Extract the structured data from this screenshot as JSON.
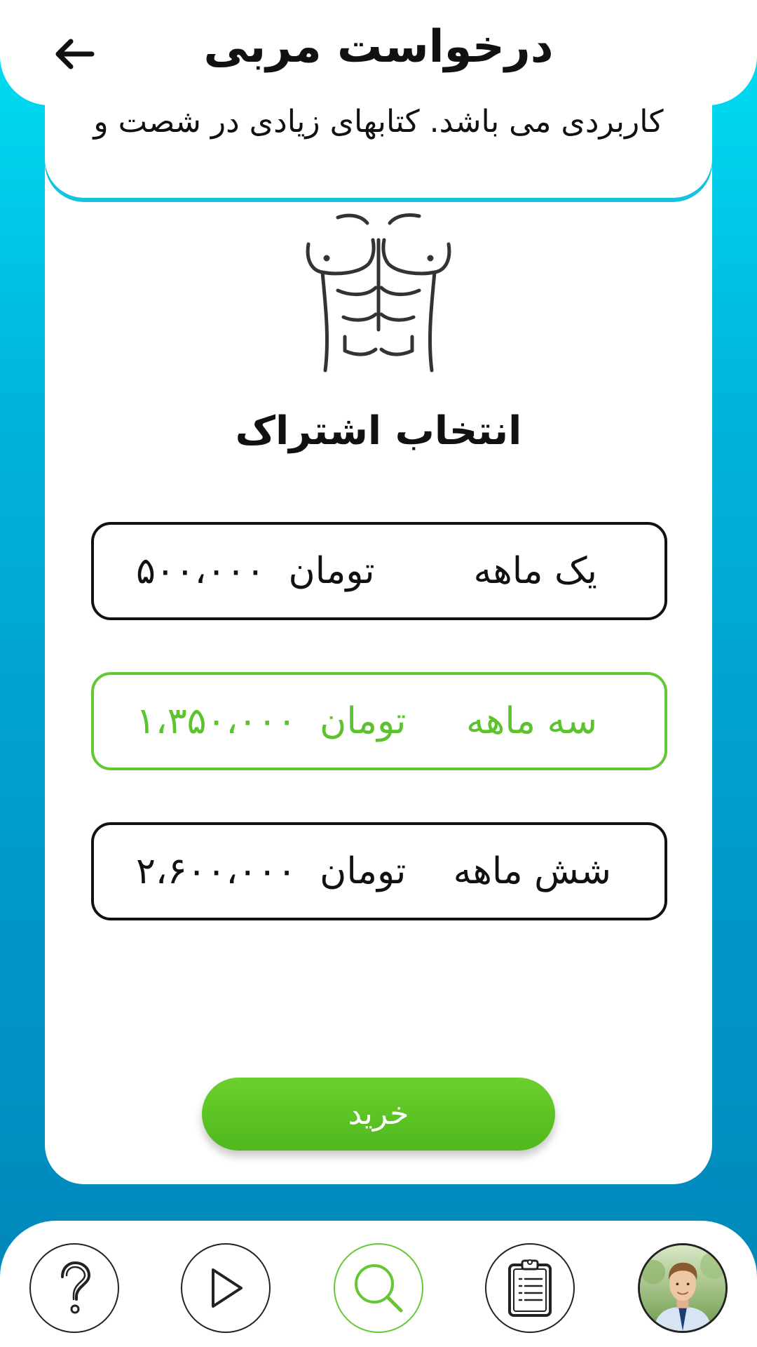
{
  "header": {
    "title": "درخواست مربی",
    "back_icon": "arrow-left-icon"
  },
  "description": {
    "text": "کاربردی می باشد. کتابهای زیادی در شصت و"
  },
  "section_title": "انتخاب اشتراک",
  "plans": [
    {
      "name": "یک ماهه",
      "price": "۵۰۰،۰۰۰",
      "currency": "تومان",
      "selected": false
    },
    {
      "name": "سه ماهه",
      "price": "۱،۳۵۰،۰۰۰",
      "currency": "تومان",
      "selected": true
    },
    {
      "name": "شش ماهه",
      "price": "۲،۶۰۰،۰۰۰",
      "currency": "تومان",
      "selected": false
    }
  ],
  "buy_button": {
    "label": "خرید"
  },
  "bottom_nav": {
    "items": [
      {
        "icon": "question-icon",
        "active": false
      },
      {
        "icon": "play-icon",
        "active": false
      },
      {
        "icon": "search-icon",
        "active": true
      },
      {
        "icon": "clipboard-icon",
        "active": false
      },
      {
        "icon": "profile-avatar",
        "active": false
      }
    ]
  },
  "colors": {
    "accent_green": "#5cc22d",
    "gradient_top": "#00e1f5",
    "gradient_bottom": "#0086b8"
  }
}
